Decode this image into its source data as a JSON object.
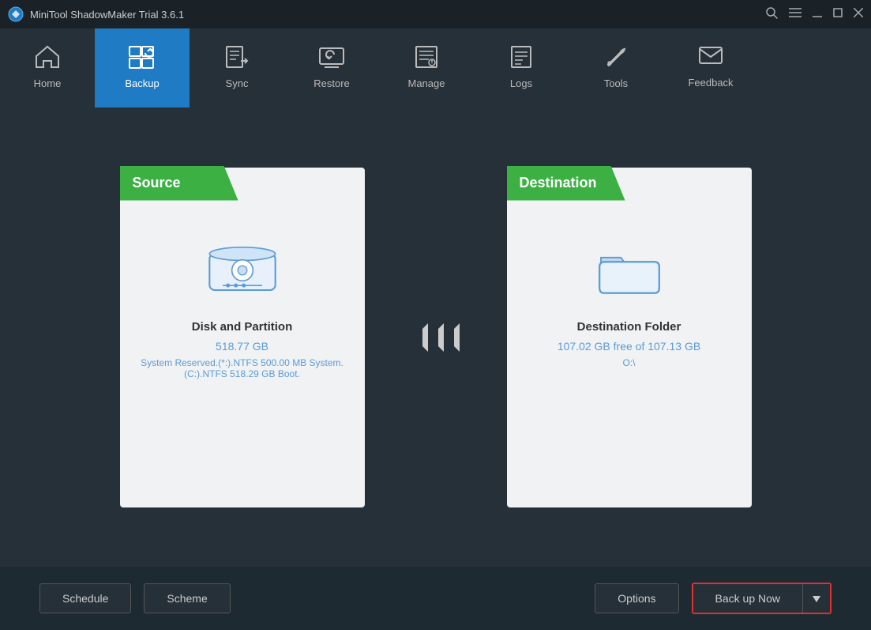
{
  "titlebar": {
    "title": "MiniTool ShadowMaker Trial 3.6.1",
    "controls": {
      "search": "🔍",
      "menu": "≡",
      "minimize": "—",
      "maximize": "☐",
      "close": "✕"
    }
  },
  "navbar": {
    "items": [
      {
        "id": "home",
        "label": "Home",
        "icon": "🏠",
        "active": false
      },
      {
        "id": "backup",
        "label": "Backup",
        "icon": "⊞↺",
        "active": true
      },
      {
        "id": "sync",
        "label": "Sync",
        "icon": "📋➡",
        "active": false
      },
      {
        "id": "restore",
        "label": "Restore",
        "icon": "🖥↺",
        "active": false
      },
      {
        "id": "manage",
        "label": "Manage",
        "icon": "📋⚙",
        "active": false
      },
      {
        "id": "logs",
        "label": "Logs",
        "icon": "📋",
        "active": false
      },
      {
        "id": "tools",
        "label": "Tools",
        "icon": "🔧",
        "active": false
      },
      {
        "id": "feedback",
        "label": "Feedback",
        "icon": "✉",
        "active": false
      }
    ]
  },
  "source": {
    "label": "Source",
    "title": "Disk and Partition",
    "size": "518.77 GB",
    "description": "System Reserved.(*:).NTFS 500.00 MB System. (C:).NTFS 518.29 GB Boot."
  },
  "destination": {
    "label": "Destination",
    "title": "Destination Folder",
    "free": "107.02 GB free of 107.13 GB",
    "path": "O:\\"
  },
  "bottombar": {
    "schedule_label": "Schedule",
    "scheme_label": "Scheme",
    "options_label": "Options",
    "backup_now_label": "Back up Now"
  }
}
